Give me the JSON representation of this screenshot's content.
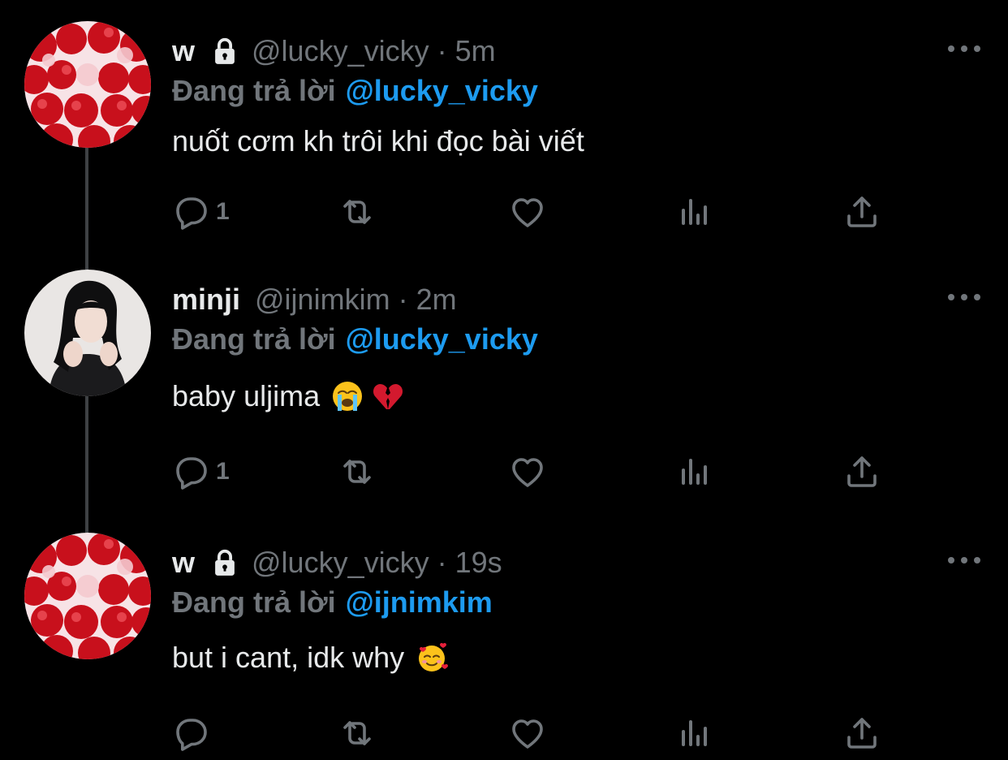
{
  "colors": {
    "background": "#000000",
    "muted": "#71767b",
    "mention": "#1d9bf0",
    "text": "#e7e9ea",
    "thread_line": "#3e4144"
  },
  "tweets": [
    {
      "name": "w",
      "locked": true,
      "handle": "@lucky_vicky",
      "separator": "·",
      "time": "5m",
      "replying_label": "Đang trả lời",
      "replying_to": "@lucky_vicky",
      "text": "nuốt cơm kh trôi khi đọc bài viết",
      "reply_count": "1",
      "avatar": "strawberries-avatar"
    },
    {
      "name": "minji",
      "locked": false,
      "handle": "@ijnimkim",
      "separator": "·",
      "time": "2m",
      "replying_label": "Đang trả lời",
      "replying_to": "@lucky_vicky",
      "text": "baby uljima",
      "emojis": [
        "loudly-crying-face-emoji",
        "broken-heart-emoji"
      ],
      "reply_count": "1",
      "avatar": "girl-photo-avatar"
    },
    {
      "name": "w",
      "locked": true,
      "handle": "@lucky_vicky",
      "separator": "·",
      "time": "19s",
      "replying_label": "Đang trả lời",
      "replying_to": "@ijnimkim",
      "text": "but i cant, idk why",
      "emojis": [
        "smiling-face-with-hearts-emoji"
      ],
      "reply_count": "",
      "avatar": "strawberries-avatar"
    }
  ],
  "icons": {
    "reply": "reply-icon",
    "retweet": "retweet-icon",
    "like": "heart-icon",
    "views": "analytics-icon",
    "share": "share-icon",
    "more": "more-icon",
    "lock": "lock-icon"
  }
}
